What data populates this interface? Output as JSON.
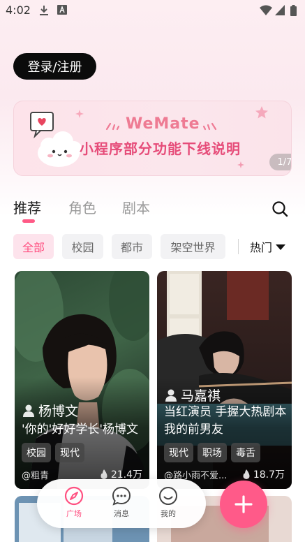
{
  "status_bar": {
    "time": "4:02"
  },
  "header": {
    "login_label": "登录/注册"
  },
  "banner": {
    "title": "WeMate",
    "subtitle": "小程序部分功能下线说明",
    "counter": "1/7"
  },
  "tabs": [
    {
      "label": "推荐",
      "active": true
    },
    {
      "label": "角色",
      "active": false
    },
    {
      "label": "剧本",
      "active": false
    }
  ],
  "filters": {
    "chips": [
      {
        "label": "全部",
        "active": true
      },
      {
        "label": "校园",
        "active": false
      },
      {
        "label": "都市",
        "active": false
      },
      {
        "label": "架空世界",
        "active": false
      }
    ],
    "sort_label": "热门"
  },
  "cards": [
    {
      "name": "杨博文",
      "description": "'你的'好好学长'杨博文",
      "tags": [
        "校园",
        "现代"
      ],
      "author": "@粗青",
      "likes": "21.4万"
    },
    {
      "name": "马嘉祺",
      "description": "当红演员 手握大热剧本 我的前男友",
      "tags": [
        "现代",
        "职场",
        "毒舌"
      ],
      "author": "@路小雨不爱...",
      "likes": "18.7万"
    }
  ],
  "bottom_nav": [
    {
      "label": "广场",
      "icon": "compass-icon",
      "active": true
    },
    {
      "label": "消息",
      "icon": "chat-icon",
      "active": false
    },
    {
      "label": "我的",
      "icon": "smile-icon",
      "active": false
    }
  ],
  "colors": {
    "accent": "#ff5a89",
    "chip_active_bg": "#fde3ec",
    "banner_text": "#e64c79"
  }
}
